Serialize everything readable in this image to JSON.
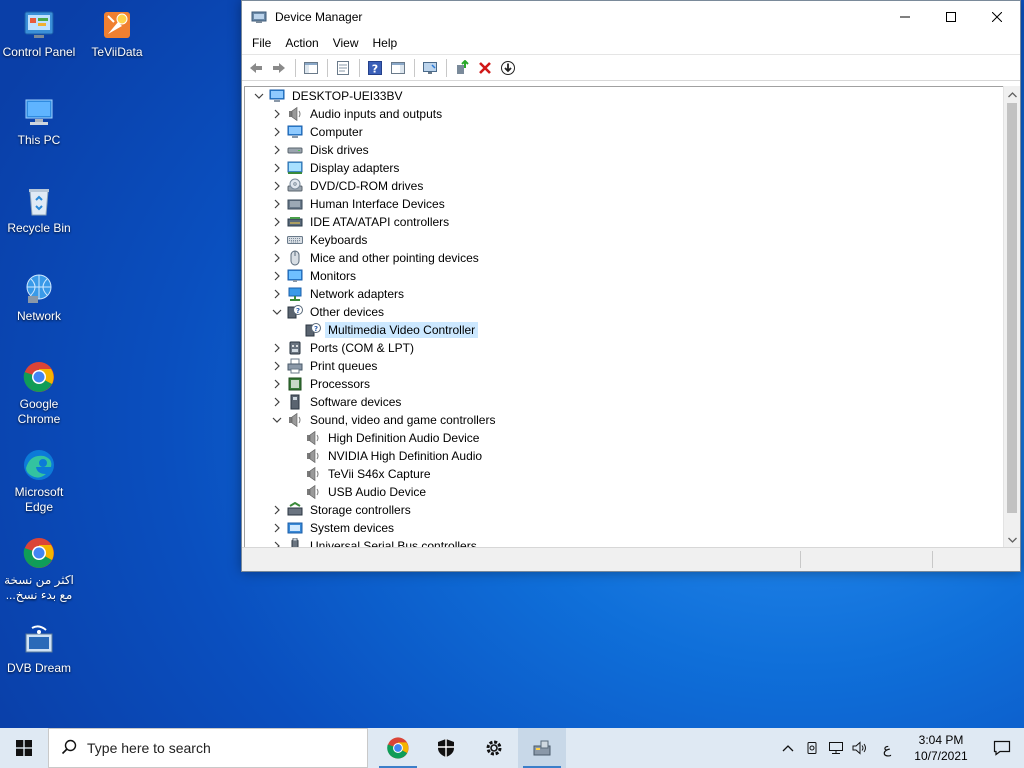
{
  "desktop": {
    "icons": [
      {
        "label": "Control Panel"
      },
      {
        "label": "TeViiData"
      },
      {
        "label": "This PC"
      },
      {
        "label": "Recycle Bin"
      },
      {
        "label": "Network"
      },
      {
        "label": "Google Chrome"
      },
      {
        "label": "Microsoft Edge"
      },
      {
        "label": "اكثر من نسخة مع بدء نسخ..."
      },
      {
        "label": "DVB Dream"
      }
    ]
  },
  "window": {
    "title": "Device Manager",
    "menu": [
      "File",
      "Action",
      "View",
      "Help"
    ],
    "root": "DESKTOP-UEI33BV",
    "tree": [
      {
        "label": "Audio inputs and outputs",
        "icon": "speaker-icon",
        "expanded": false
      },
      {
        "label": "Computer",
        "icon": "computer-icon",
        "expanded": false
      },
      {
        "label": "Disk drives",
        "icon": "disk-drive-icon",
        "expanded": false
      },
      {
        "label": "Display adapters",
        "icon": "display-adapter-icon",
        "expanded": false
      },
      {
        "label": "DVD/CD-ROM drives",
        "icon": "dvd-drive-icon",
        "expanded": false
      },
      {
        "label": "Human Interface Devices",
        "icon": "hid-icon",
        "expanded": false
      },
      {
        "label": "IDE ATA/ATAPI controllers",
        "icon": "ide-controller-icon",
        "expanded": false
      },
      {
        "label": "Keyboards",
        "icon": "keyboard-icon",
        "expanded": false
      },
      {
        "label": "Mice and other pointing devices",
        "icon": "mouse-icon",
        "expanded": false
      },
      {
        "label": "Monitors",
        "icon": "monitor-icon",
        "expanded": false
      },
      {
        "label": "Network adapters",
        "icon": "network-adapter-icon",
        "expanded": false
      },
      {
        "label": "Other devices",
        "icon": "unknown-device-icon",
        "expanded": true,
        "children": [
          {
            "label": "Multimedia Video Controller",
            "icon": "unknown-device-icon",
            "selected": true
          }
        ]
      },
      {
        "label": "Ports (COM & LPT)",
        "icon": "port-icon",
        "expanded": false
      },
      {
        "label": "Print queues",
        "icon": "printer-icon",
        "expanded": false
      },
      {
        "label": "Processors",
        "icon": "processor-icon",
        "expanded": false
      },
      {
        "label": "Software devices",
        "icon": "software-device-icon",
        "expanded": false
      },
      {
        "label": "Sound, video and game controllers",
        "icon": "speaker-icon",
        "expanded": true,
        "children": [
          {
            "label": "High Definition Audio Device",
            "icon": "speaker-icon"
          },
          {
            "label": "NVIDIA High Definition Audio",
            "icon": "speaker-icon"
          },
          {
            "label": "TeVii S46x Capture",
            "icon": "speaker-icon"
          },
          {
            "label": "USB Audio Device",
            "icon": "speaker-icon"
          }
        ]
      },
      {
        "label": "Storage controllers",
        "icon": "storage-controller-icon",
        "expanded": false
      },
      {
        "label": "System devices",
        "icon": "system-device-icon",
        "expanded": false
      },
      {
        "label": "Universal Serial Bus controllers",
        "icon": "usb-icon",
        "expanded": false
      }
    ]
  },
  "taskbar": {
    "search_placeholder": "Type here to search",
    "language": "ع",
    "time": "3:04 PM",
    "date": "10/7/2021"
  }
}
